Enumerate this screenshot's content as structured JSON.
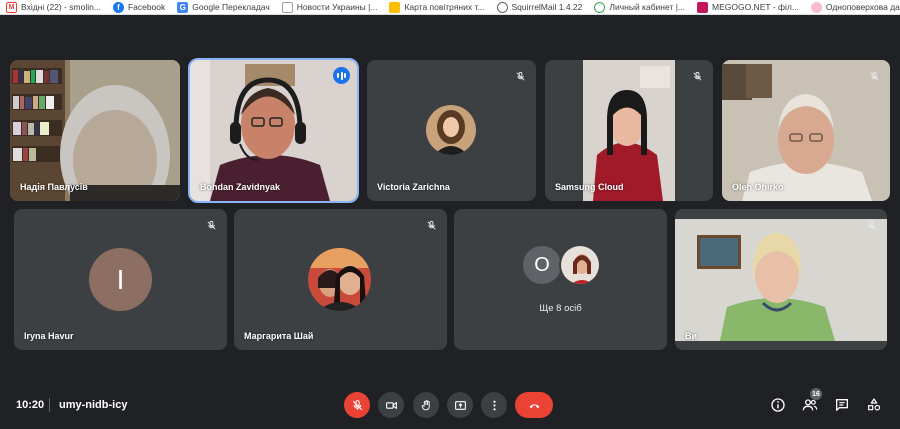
{
  "bookmarks": [
    {
      "icon": "gmail-icon",
      "glyph": "M",
      "color": "#ea4335",
      "label": "Вхідні (22) - smolin..."
    },
    {
      "icon": "facebook-icon",
      "glyph": "f",
      "color": "#1877f2",
      "label": "Facebook"
    },
    {
      "icon": "google-translate-icon",
      "glyph": "G",
      "color": "#4285f4",
      "label": "Google Перекладач"
    },
    {
      "icon": "news-icon",
      "glyph": "",
      "color": "#5f6368",
      "label": "Новости Украины |..."
    },
    {
      "icon": "map-icon",
      "glyph": "",
      "color": "#fbbc04",
      "label": "Карта повітряних т..."
    },
    {
      "icon": "squirrelmail-icon",
      "glyph": "",
      "color": "#5f6368",
      "label": "SquirrelMail 1.4.22"
    },
    {
      "icon": "cabinet-icon",
      "glyph": "",
      "color": "#34a853",
      "label": "Личный кабинет |..."
    },
    {
      "icon": "megogo-icon",
      "glyph": "",
      "color": "#c2185b",
      "label": "MEGOGO.NET - філ..."
    },
    {
      "icon": "house-icon",
      "glyph": "",
      "color": "#e57373",
      "label": "Одноповерхова да..."
    }
  ],
  "participants": [
    {
      "name": "Надія Павлусів",
      "muted": false,
      "speaking": false
    },
    {
      "name": "Bohdan Zavidnyak",
      "muted": false,
      "speaking": true
    },
    {
      "name": "Victoria Zarichna",
      "muted": true,
      "speaking": false
    },
    {
      "name": "Samsung Cloud",
      "muted": true,
      "speaking": false
    },
    {
      "name": "Oleh Ohirko",
      "muted": true,
      "speaking": false
    },
    {
      "name": "Iryna Havur",
      "muted": true,
      "speaking": false,
      "initial": "I"
    },
    {
      "name": "Маргарита Шай",
      "muted": true,
      "speaking": false
    },
    {
      "more_label": "Ще 8 осіб",
      "initial": "O"
    },
    {
      "name": "Ви",
      "muted": true,
      "speaking": false
    }
  ],
  "meeting": {
    "time": "10:20",
    "code": "umy-nidb-icy",
    "people_count": "16"
  },
  "colors": {
    "background": "#202124",
    "tile": "#3c4043",
    "accent": "#1a73e8",
    "danger": "#ea4335"
  }
}
